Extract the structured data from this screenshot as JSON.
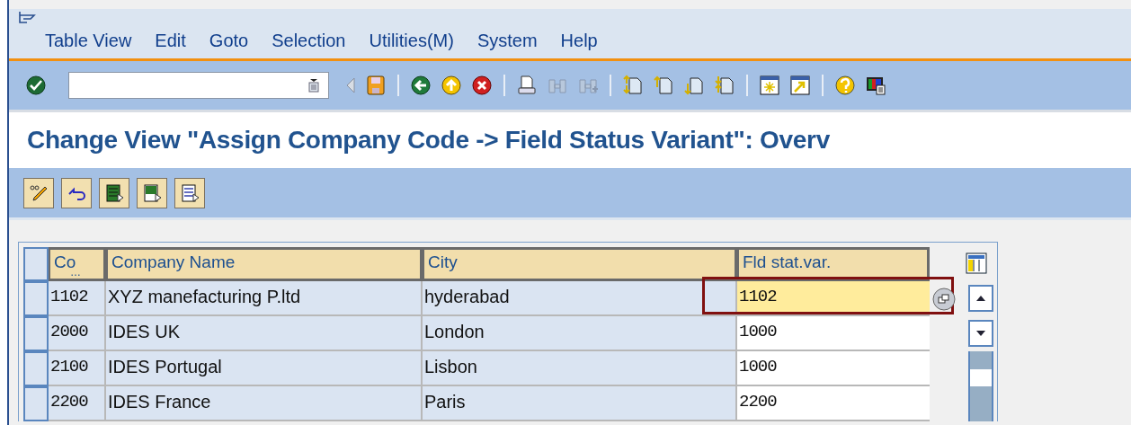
{
  "menu": [
    {
      "label": "Table View"
    },
    {
      "label": "Edit"
    },
    {
      "label": "Goto"
    },
    {
      "label": "Selection"
    },
    {
      "label": "Utilities(M)"
    },
    {
      "label": "System"
    },
    {
      "label": "Help"
    }
  ],
  "title": "Change View \"Assign Company Code -> Field Status Variant\": Overv",
  "table": {
    "columns": [
      {
        "label": "Co",
        "overflow_mark": "…"
      },
      {
        "label": "Company Name"
      },
      {
        "label": "City"
      },
      {
        "label": "Fld stat.var."
      }
    ],
    "rows": [
      {
        "cells": [
          "1102",
          "XYZ manefacturing P.ltd",
          "hyderabad",
          "1102"
        ],
        "focused": true
      },
      {
        "cells": [
          "2000",
          "IDES UK",
          "London",
          "1000"
        ],
        "focused": false
      },
      {
        "cells": [
          "2100",
          "IDES Portugal",
          "Lisbon",
          "1000"
        ],
        "focused": false
      },
      {
        "cells": [
          "2200",
          "IDES France",
          "Paris",
          "2200"
        ],
        "focused": false
      }
    ]
  }
}
